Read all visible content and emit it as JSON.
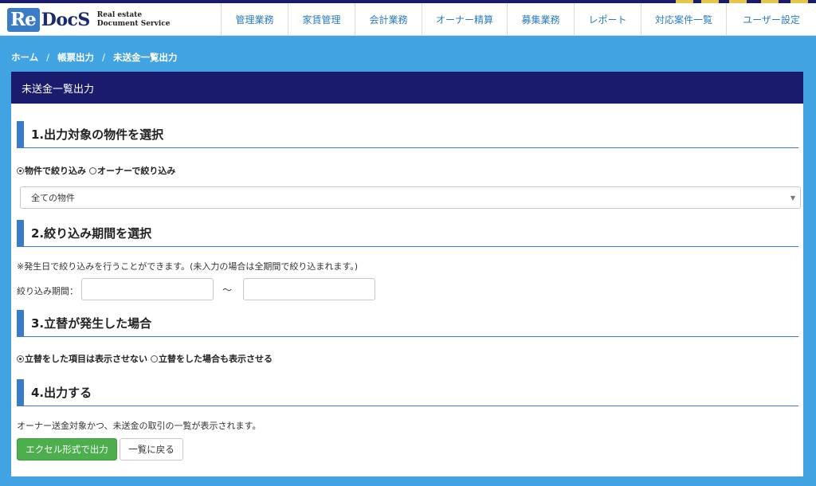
{
  "brand": {
    "logo_mark": "Re",
    "logo_rest": "DocS",
    "tagline_line1": "Real estate",
    "tagline_line2": "Document Service"
  },
  "nav": [
    {
      "label": "管理業務"
    },
    {
      "label": "家賃管理"
    },
    {
      "label": "会計業務"
    },
    {
      "label": "オーナー精算"
    },
    {
      "label": "募集業務"
    },
    {
      "label": "レポート"
    },
    {
      "label": "対応案件一覧"
    },
    {
      "label": "ユーザー設定"
    }
  ],
  "breadcrumb": [
    "ホーム",
    "帳票出力",
    "未送金一覧出力"
  ],
  "breadcrumb_sep": "/",
  "panel": {
    "title": "未送金一覧出力",
    "section1": {
      "title": "1.出力対象の物件を選択",
      "radios": [
        {
          "label": "物件で絞り込み",
          "checked": true
        },
        {
          "label": "オーナーで絞り込み",
          "checked": false
        }
      ],
      "select_value": "全ての物件"
    },
    "section2": {
      "title": "2.絞り込み期間を選択",
      "note": "※発生日で絞り込みを行うことができます。(未入力の場合は全期間で絞り込まれます。)",
      "period_label": "絞り込み期間：",
      "from_value": "",
      "to_value": "",
      "tilde": "〜"
    },
    "section3": {
      "title": "3.立替が発生した場合",
      "radios": [
        {
          "label": "立替をした項目は表示させない",
          "checked": true
        },
        {
          "label": "立替をした場合も表示させる",
          "checked": false
        }
      ]
    },
    "section4": {
      "title": "4.出力する",
      "note": "オーナー送金対象かつ、未送金の取引の一覧が表示されます。",
      "excel_button": "エクセル形式で出力",
      "back_button": "一覧に戻る"
    }
  },
  "colors": {
    "background": "#41a3e2",
    "panel_header": "#1b1b6e",
    "section_accent": "#3a7cc6",
    "nav_text": "#2a7bc0",
    "excel_button": "#4cae4c"
  }
}
